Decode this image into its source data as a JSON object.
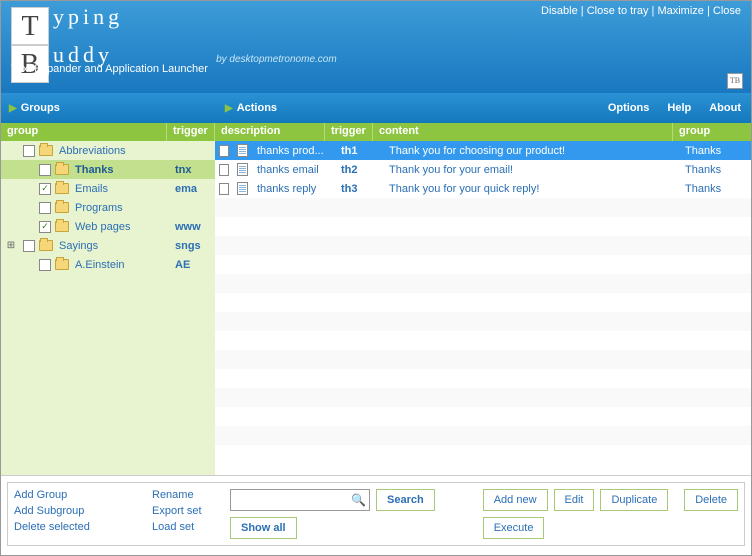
{
  "topbar": {
    "disable": "Disable",
    "close_tray": "Close to tray",
    "maximize": "Maximize",
    "close": "Close"
  },
  "logo": {
    "letter1": "T",
    "word1": "yping",
    "letter2": "B",
    "word2": "uddy",
    "byline": "by desktopmetronome.com",
    "tagline": "Text Expander and Application Launcher",
    "tray": "TB"
  },
  "menubar": {
    "groups": "Groups",
    "actions": "Actions",
    "options": "Options",
    "help": "Help",
    "about": "About"
  },
  "headers": {
    "group": "group",
    "trigger": "trigger",
    "description": "description",
    "content": "content"
  },
  "tree": [
    {
      "label": "Abbreviations",
      "trigger": "",
      "checked": false,
      "indent": 0,
      "expander": ""
    },
    {
      "label": "Thanks",
      "trigger": "tnx",
      "checked": false,
      "indent": 1,
      "expander": "",
      "selected": true
    },
    {
      "label": "Emails",
      "trigger": "ema",
      "checked": true,
      "indent": 1,
      "expander": ""
    },
    {
      "label": "Programs",
      "trigger": "",
      "checked": false,
      "indent": 1,
      "expander": ""
    },
    {
      "label": "Web pages",
      "trigger": "www",
      "checked": true,
      "indent": 1,
      "expander": ""
    },
    {
      "label": "Sayings",
      "trigger": "sngs",
      "checked": false,
      "indent": 0,
      "expander": "+"
    },
    {
      "label": "A.Einstein",
      "trigger": "AE",
      "checked": false,
      "indent": 1,
      "expander": ""
    }
  ],
  "actions": [
    {
      "description": "thanks prod...",
      "trigger": "th1",
      "content": "Thank you for choosing our product!",
      "group": "Thanks",
      "checked": false,
      "selected": true
    },
    {
      "description": "thanks email",
      "trigger": "th2",
      "content": "Thank you for your email!",
      "group": "Thanks",
      "checked": false
    },
    {
      "description": "thanks reply",
      "trigger": "th3",
      "content": "Thank you for your quick reply!",
      "group": "Thanks",
      "checked": false
    }
  ],
  "footer": {
    "add_group": "Add Group",
    "add_subgroup": "Add Subgroup",
    "delete_selected": "Delete selected",
    "rename": "Rename",
    "export_set": "Export set",
    "load_set": "Load set",
    "search": "Search",
    "show_all": "Show all",
    "add_new": "Add new",
    "edit": "Edit",
    "duplicate": "Duplicate",
    "execute": "Execute",
    "delete": "Delete",
    "search_placeholder": ""
  }
}
